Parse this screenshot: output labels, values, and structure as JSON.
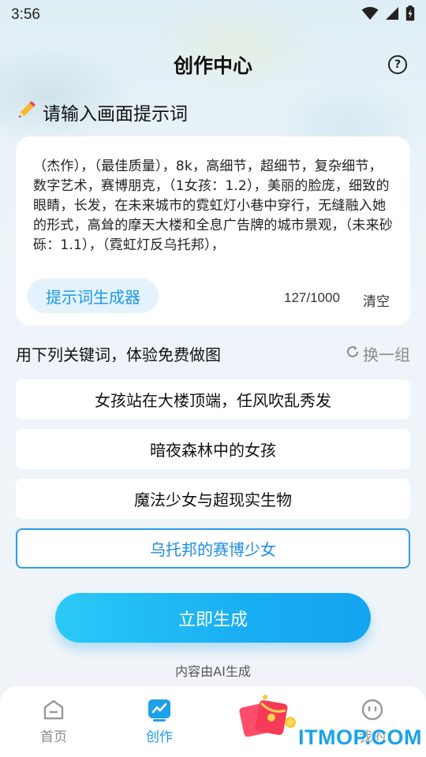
{
  "status_bar": {
    "time": "3:56",
    "icons": [
      "wifi-icon",
      "signal-icon",
      "battery-charging-icon"
    ]
  },
  "header": {
    "title": "创作中心",
    "help_icon": "question-circle-icon"
  },
  "prompt": {
    "label": "请输入画面提示词",
    "label_icon": "pencil-icon",
    "text": "（杰作），（最佳质量），8k，高细节，超细节，复杂细节，数字艺术，赛博朋克，（1女孩：1.2），美丽的脸庞，细致的眼睛，长发，在未来城市的霓虹灯小巷中穿行，无缝融入她的形式，高耸的摩天大楼和全息广告牌的城市景观，（未来砂砾：1.1），（霓虹灯反乌托邦），",
    "generator_button": "提示词生成器",
    "char_count": "127/1000",
    "clear_button": "清空"
  },
  "keywords": {
    "title": "用下列关键词，体验免费做图",
    "refresh_label": "换一组",
    "refresh_icon": "refresh-icon",
    "items": [
      {
        "label": "女孩站在大楼顶端，任风吹乱秀发",
        "selected": false
      },
      {
        "label": "暗夜森林中的女孩",
        "selected": false
      },
      {
        "label": "魔法少女与超现实生物",
        "selected": false
      },
      {
        "label": "乌托邦的赛博少女",
        "selected": true
      }
    ]
  },
  "generate_button": "立即生成",
  "ai_note": "内容由AI生成",
  "tabbar": {
    "tabs": [
      {
        "label": "首页",
        "icon": "home-icon",
        "active": false
      },
      {
        "label": "创作",
        "icon": "create-icon",
        "active": true
      },
      {
        "label": "",
        "icon": "red-envelope-icon",
        "active": false
      },
      {
        "label": "我的",
        "icon": "profile-icon",
        "active": false
      }
    ]
  },
  "watermark": "ITMOP.COM",
  "colors": {
    "accent": "#1e9be6",
    "button_gradient_start": "#2bc9f7",
    "button_gradient_end": "#16a4f0",
    "background": "#eef4f9"
  }
}
